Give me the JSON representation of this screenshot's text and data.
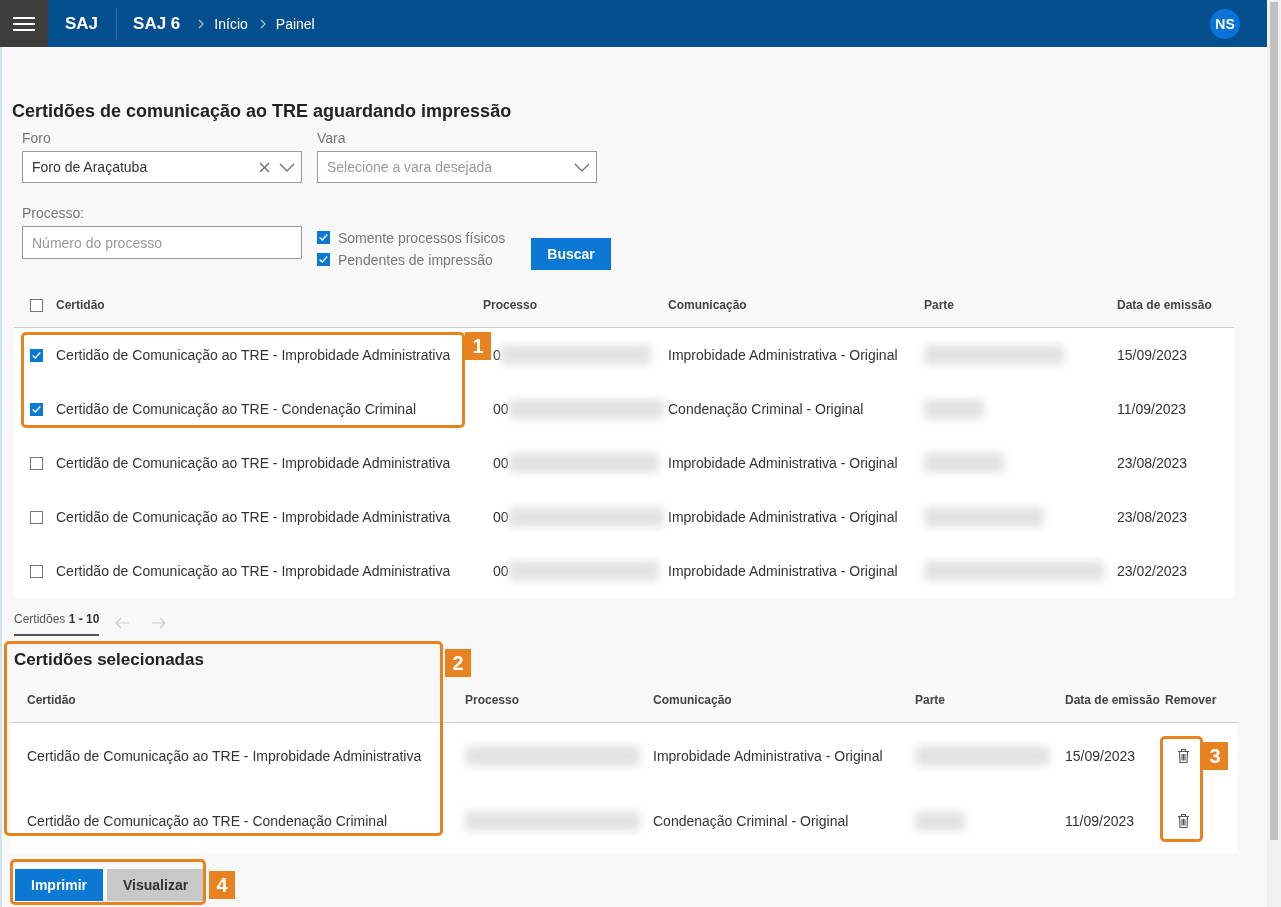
{
  "topbar": {
    "app": "SAJ",
    "product": "SAJ 6",
    "breadcrumb": [
      "Início",
      "Painel"
    ],
    "avatar": "NS"
  },
  "title": "Certidões de comunicação ao TRE aguardando impressão",
  "filters": {
    "foro": {
      "label": "Foro",
      "value": "Foro de Araçatuba",
      "clearable": true
    },
    "vara": {
      "label": "Vara",
      "placeholder": "Selecione a vara desejada"
    },
    "processo": {
      "label": "Processo:",
      "placeholder": "Número do processo"
    },
    "options": [
      {
        "label": "Somente processos físicos",
        "checked": true
      },
      {
        "label": "Pendentes de impressão",
        "checked": true
      }
    ],
    "search_button": "Buscar"
  },
  "table": {
    "select_all": false,
    "columns": [
      "Certidão",
      "Processo",
      "Comunicação",
      "Parte",
      "Data de emissão"
    ],
    "rows": [
      {
        "checked": true,
        "certidao": "Certidão de Comunicação ao TRE - Improbidade Administrativa",
        "processo": "0",
        "processo_redacted": true,
        "comunicacao": "Improbidade Administrativa - Original",
        "parte_redacted": true,
        "data": "15/09/2023"
      },
      {
        "checked": true,
        "certidao": "Certidão de Comunicação ao TRE - Condenação Criminal",
        "processo": "00",
        "processo_redacted": true,
        "comunicacao": "Condenação Criminal - Original",
        "parte_redacted": true,
        "data": "11/09/2023"
      },
      {
        "checked": false,
        "certidao": "Certidão de Comunicação ao TRE - Improbidade Administrativa",
        "processo": "00",
        "processo_redacted": true,
        "comunicacao": "Improbidade Administrativa - Original",
        "parte_redacted": true,
        "data": "23/08/2023"
      },
      {
        "checked": false,
        "certidao": "Certidão de Comunicação ao TRE - Improbidade Administrativa",
        "processo": "00",
        "processo_redacted": true,
        "comunicacao": "Improbidade Administrativa - Original",
        "parte_redacted": true,
        "data": "23/08/2023"
      },
      {
        "checked": false,
        "certidao": "Certidão de Comunicação ao TRE - Improbidade Administrativa",
        "processo": "00",
        "processo_redacted": true,
        "comunicacao": "Improbidade Administrativa - Original",
        "parte_redacted": true,
        "data": "23/02/2023"
      }
    ],
    "pagination": {
      "label": "Certidões **1 - 10**",
      "prev_disabled": true,
      "next_disabled": true
    }
  },
  "selected": {
    "title": "Certidões selecionadas",
    "columns": [
      "Certidão",
      "Processo",
      "Comunicação",
      "Parte",
      "Data de emissão",
      "Remover"
    ],
    "rows": [
      {
        "certidao": "Certidão de Comunicação ao TRE - Improbidade Administrativa",
        "processo_redacted": true,
        "comunicacao": "Improbidade Administrativa - Original",
        "parte_redacted": true,
        "data": "15/09/2023"
      },
      {
        "certidao": "Certidão de Comunicação ao TRE - Condenação Criminal",
        "processo_redacted": true,
        "comunicacao": "Condenação Criminal - Original",
        "parte_redacted": true,
        "data": "11/09/2023"
      }
    ]
  },
  "actions": [
    {
      "label": "Imprimir",
      "kind": "primary"
    },
    {
      "label": "Visualizar",
      "kind": "secondary"
    }
  ],
  "callouts": [
    {
      "label": "1"
    },
    {
      "label": "2"
    },
    {
      "label": "3"
    },
    {
      "label": "4"
    }
  ]
}
